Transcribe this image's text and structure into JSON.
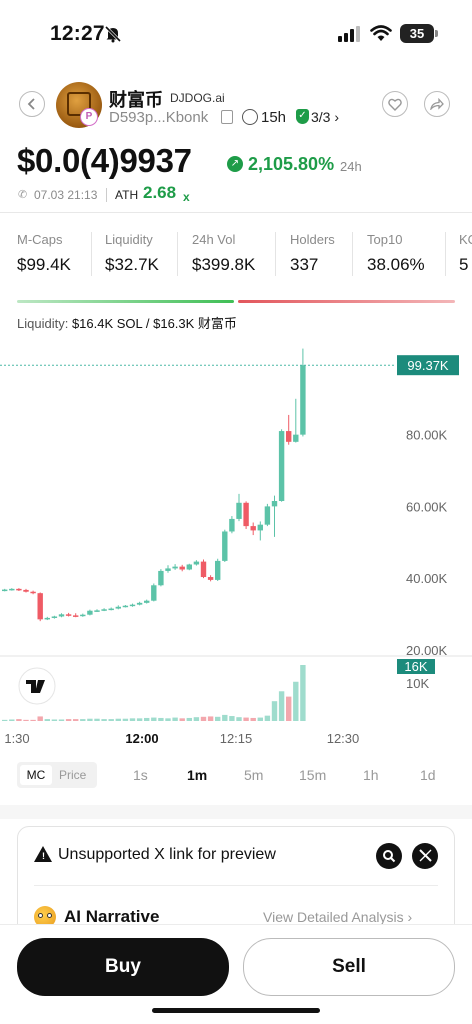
{
  "status_bar": {
    "time": "12:27",
    "battery": "35"
  },
  "token": {
    "name": "财富币",
    "site": "DJDOG.ai",
    "address": "D593p...Kbonk",
    "age": "15h",
    "audit": "3/3 ›",
    "price": "$0.0(4)9937",
    "change": "2,105.80%",
    "change_period": "24h",
    "created": "07.03 21:13",
    "ath_label": "ATH",
    "ath_value": "2.68",
    "ath_suffix": "x"
  },
  "stats": [
    {
      "label": "M-Caps",
      "value": "$99.4K"
    },
    {
      "label": "Liquidity",
      "value": "$32.7K"
    },
    {
      "label": "24h Vol",
      "value": "$399.8K"
    },
    {
      "label": "Holders",
      "value": "337"
    },
    {
      "label": "Top10",
      "value": "38.06%"
    },
    {
      "label": "KO",
      "value": "5"
    }
  ],
  "liquidity": {
    "label": "Liquidity:",
    "value": "$16.4K SOL / $16.3K 财富币"
  },
  "chart_data": {
    "type": "candlestick",
    "y_unit": "market cap",
    "ylim": [
      18000,
      105000
    ],
    "y_ticks": [
      "80.00K",
      "60.00K",
      "40.00K",
      "20.00K"
    ],
    "y_tick_values": [
      80000,
      60000,
      40000,
      20000
    ],
    "current_label": "99.37K",
    "current_value": 99370,
    "volume_label_current": "16K",
    "volume_tick": "10K",
    "x_ticks": [
      "1:30",
      "12:00",
      "12:15",
      "12:30"
    ],
    "up_color": "#5cc3a8",
    "down_color": "#ef5b65",
    "candles": [
      {
        "o": 36500,
        "h": 37000,
        "c": 36800,
        "l": 36300
      },
      {
        "o": 36800,
        "h": 37200,
        "c": 37000,
        "l": 36500
      },
      {
        "o": 37000,
        "h": 37200,
        "c": 36700,
        "l": 36400
      },
      {
        "o": 36700,
        "h": 37000,
        "c": 36200,
        "l": 36000
      },
      {
        "o": 36200,
        "h": 36500,
        "c": 35800,
        "l": 35500
      },
      {
        "o": 35800,
        "h": 36000,
        "c": 28500,
        "l": 28000
      },
      {
        "o": 28500,
        "h": 29200,
        "c": 28900,
        "l": 28300
      },
      {
        "o": 28900,
        "h": 29500,
        "c": 29300,
        "l": 28700
      },
      {
        "o": 29300,
        "h": 30200,
        "c": 29900,
        "l": 29100
      },
      {
        "o": 29900,
        "h": 30300,
        "c": 29600,
        "l": 29300
      },
      {
        "o": 29600,
        "h": 30200,
        "c": 29400,
        "l": 29100
      },
      {
        "o": 29400,
        "h": 30100,
        "c": 29800,
        "l": 29200
      },
      {
        "o": 29800,
        "h": 31200,
        "c": 30900,
        "l": 29600
      },
      {
        "o": 30900,
        "h": 31300,
        "c": 31000,
        "l": 30600
      },
      {
        "o": 31000,
        "h": 31600,
        "c": 31300,
        "l": 30800
      },
      {
        "o": 31300,
        "h": 31800,
        "c": 31500,
        "l": 31000
      },
      {
        "o": 31500,
        "h": 32400,
        "c": 32000,
        "l": 31300
      },
      {
        "o": 32000,
        "h": 32500,
        "c": 32300,
        "l": 31800
      },
      {
        "o": 32300,
        "h": 32900,
        "c": 32600,
        "l": 32000
      },
      {
        "o": 32600,
        "h": 33400,
        "c": 33100,
        "l": 32400
      },
      {
        "o": 33100,
        "h": 34000,
        "c": 33700,
        "l": 32900
      },
      {
        "o": 33700,
        "h": 38500,
        "c": 38000,
        "l": 33500
      },
      {
        "o": 38000,
        "h": 42500,
        "c": 42000,
        "l": 37700
      },
      {
        "o": 42000,
        "h": 43600,
        "c": 42700,
        "l": 41500
      },
      {
        "o": 42700,
        "h": 43900,
        "c": 43200,
        "l": 42300
      },
      {
        "o": 43200,
        "h": 43700,
        "c": 42400,
        "l": 41900
      },
      {
        "o": 42400,
        "h": 44000,
        "c": 43800,
        "l": 42200
      },
      {
        "o": 43800,
        "h": 45000,
        "c": 44600,
        "l": 43500
      },
      {
        "o": 44600,
        "h": 45200,
        "c": 40300,
        "l": 40000
      },
      {
        "o": 40300,
        "h": 40800,
        "c": 39500,
        "l": 39100
      },
      {
        "o": 39500,
        "h": 45400,
        "c": 44800,
        "l": 39200
      },
      {
        "o": 44800,
        "h": 53500,
        "c": 53000,
        "l": 44500
      },
      {
        "o": 53000,
        "h": 57300,
        "c": 56500,
        "l": 52500
      },
      {
        "o": 56500,
        "h": 63500,
        "c": 61000,
        "l": 55900
      },
      {
        "o": 61000,
        "h": 61400,
        "c": 54500,
        "l": 53700
      },
      {
        "o": 54500,
        "h": 55500,
        "c": 53300,
        "l": 52000
      },
      {
        "o": 53300,
        "h": 55800,
        "c": 54900,
        "l": 50500
      },
      {
        "o": 54900,
        "h": 60700,
        "c": 60000,
        "l": 54500
      },
      {
        "o": 60000,
        "h": 63000,
        "c": 61500,
        "l": 51500
      },
      {
        "o": 61500,
        "h": 81500,
        "c": 81000,
        "l": 61300
      },
      {
        "o": 81000,
        "h": 85500,
        "c": 78000,
        "l": 77200
      },
      {
        "o": 78000,
        "h": 90000,
        "c": 80000,
        "l": 77800
      },
      {
        "o": 80000,
        "h": 104000,
        "c": 99370,
        "l": 79500
      }
    ],
    "volumes": [
      0.3,
      0.4,
      0.5,
      0.3,
      0.3,
      1.2,
      0.5,
      0.4,
      0.4,
      0.5,
      0.5,
      0.5,
      0.6,
      0.6,
      0.5,
      0.5,
      0.6,
      0.6,
      0.7,
      0.7,
      0.8,
      0.9,
      0.8,
      0.7,
      0.9,
      0.7,
      0.8,
      1.0,
      1.1,
      1.2,
      1.1,
      1.6,
      1.3,
      1.0,
      0.9,
      0.8,
      0.9,
      1.4,
      5.2,
      7.8,
      6.4,
      10.3,
      14.7
    ]
  },
  "chart_tabs": {
    "mc": "MC",
    "price": "Price",
    "timeframes": [
      "1s",
      "1m",
      "5m",
      "15m",
      "1h",
      "1d"
    ],
    "active": "1m"
  },
  "card": {
    "warning": "Unsupported X link for preview",
    "ai_title": "AI Narrative",
    "ai_link": "View Detailed Analysis ›"
  },
  "actions": {
    "buy": "Buy",
    "sell": "Sell"
  }
}
